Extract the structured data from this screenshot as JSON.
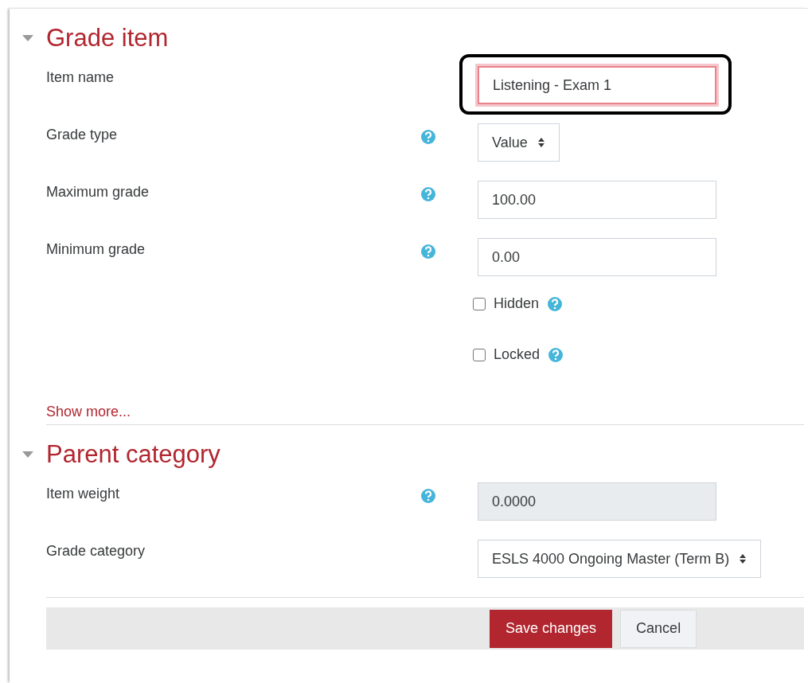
{
  "sections": [
    {
      "title": "Grade item",
      "expanded": true,
      "rows": [
        {
          "kind": "text",
          "label": "Item name",
          "value": "Listening - Exam 1",
          "help": false,
          "error": true,
          "highlighted": true
        },
        {
          "kind": "select",
          "label": "Grade type",
          "value": "Value",
          "help": true
        },
        {
          "kind": "text",
          "label": "Maximum grade",
          "value": "100.00",
          "help": true
        },
        {
          "kind": "text",
          "label": "Minimum grade",
          "value": "0.00",
          "help": true
        },
        {
          "kind": "checkbox",
          "label": "Hidden",
          "checked": false,
          "help": true
        },
        {
          "kind": "checkbox",
          "label": "Locked",
          "checked": false,
          "help": true
        }
      ],
      "link": "Show more..."
    },
    {
      "title": "Parent category",
      "expanded": true,
      "rows": [
        {
          "kind": "text",
          "label": "Item weight",
          "value": "0.0000",
          "help": true,
          "disabled": true
        },
        {
          "kind": "select",
          "label": "Grade category",
          "value": "ESLS 4000 Ongoing Master (Term B)",
          "help": false
        }
      ]
    }
  ],
  "buttons": [
    {
      "label": "Save changes",
      "primary": true
    },
    {
      "label": "Cancel",
      "primary": false
    }
  ]
}
